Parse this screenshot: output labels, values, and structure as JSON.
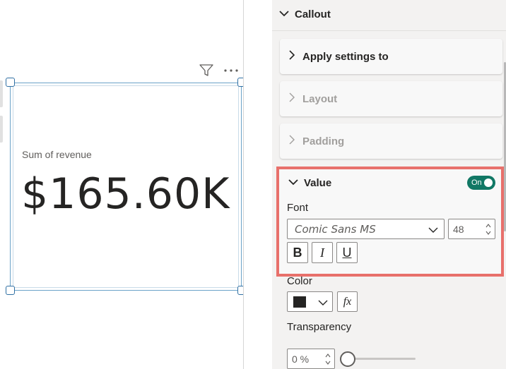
{
  "canvas": {
    "visual": {
      "label": "Sum of revenue",
      "value": "$165.60K"
    },
    "header_icons": [
      "filter-icon",
      "more-options-icon"
    ]
  },
  "format_pane": {
    "section_title": "Callout",
    "sections": {
      "apply": "Apply settings to",
      "layout": "Layout",
      "padding": "Padding",
      "value": "Value"
    },
    "value": {
      "toggle_label": "On",
      "font_label": "Font",
      "font_family": "Comic Sans MS",
      "font_size": "48",
      "bold": "B",
      "italic": "I",
      "underline": "U",
      "color_label": "Color",
      "color_swatch": "#252423",
      "fx_label": "fx",
      "transparency_label": "Transparency",
      "transparency_value": "0 %",
      "transparency_percent": 0
    }
  },
  "colors": {
    "accent_toggle": "#117865",
    "highlight_border": "#e8706b",
    "selection_border": "#2f6fa3"
  }
}
